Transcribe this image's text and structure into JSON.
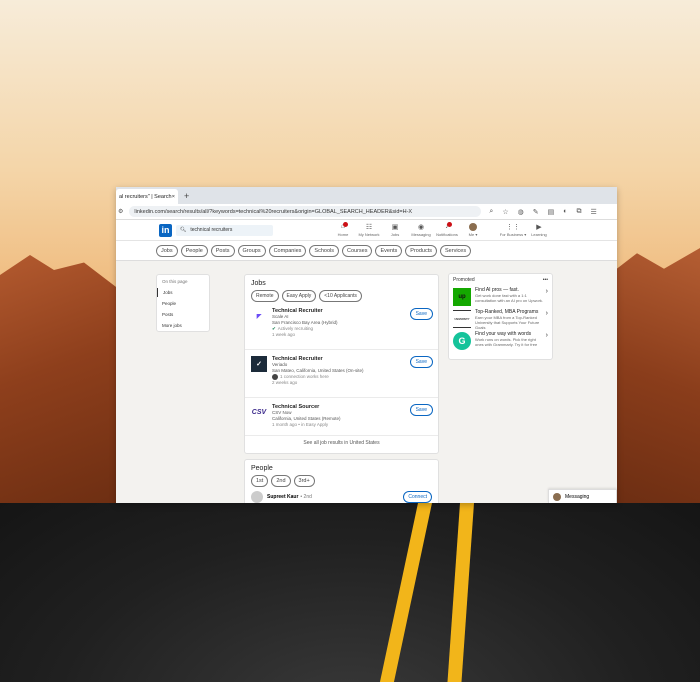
{
  "browser": {
    "tab_title": "al recruiters\" | Search",
    "tab_close": "×",
    "new_tab": "+",
    "url": "linkedin.com/search/results/all/?keywords=technical%20recruiters&origin=GLOBAL_SEARCH_HEADER&sid=H-X"
  },
  "linkedin_nav": {
    "logo": "in",
    "search_value": "technical recruiters",
    "items": [
      {
        "label": "Home",
        "icon": "home-icon",
        "glyph": "⌂",
        "badge": true
      },
      {
        "label": "My Network",
        "icon": "network-icon",
        "glyph": "☷",
        "badge": false
      },
      {
        "label": "Jobs",
        "icon": "briefcase-icon",
        "glyph": "▣",
        "badge": false
      },
      {
        "label": "Messaging",
        "icon": "message-icon",
        "glyph": "◉",
        "badge": false
      },
      {
        "label": "Notifications",
        "icon": "bell-icon",
        "glyph": "♪",
        "badge": true
      },
      {
        "label": "Me ▾",
        "icon": "avatar",
        "glyph": "",
        "badge": false
      }
    ],
    "business": "For Business ▾",
    "learning": "Learning"
  },
  "filters": [
    "Jobs",
    "People",
    "Posts",
    "Groups",
    "Companies",
    "Schools",
    "Courses",
    "Events",
    "Products",
    "Services"
  ],
  "left_nav": {
    "title": "On this page",
    "items": [
      "Jobs",
      "People",
      "Posts",
      "More jobs"
    ]
  },
  "jobs": {
    "title": "Jobs",
    "filters": [
      "Remote",
      "Easy Apply",
      "<10 Applicants"
    ],
    "list": [
      {
        "title": "Technical Recruiter",
        "company": "Scale AI",
        "location": "San Francisco Bay Area (Hybrid)",
        "meta": "Actively recruiting",
        "time": "1 week ago"
      },
      {
        "title": "Technical Recruiter",
        "company": "Veriado",
        "location": "San Mateo, California, United States (On-site)",
        "meta": "1 connection works here",
        "time": "2 weeks ago"
      },
      {
        "title": "Technical Sourcer",
        "company": "CSV Now",
        "location": "California, United States (Remote)",
        "meta": "1 month ago • in Easy Apply",
        "time": ""
      }
    ],
    "save_label": "Save",
    "see_all": "See all job results in United States"
  },
  "people": {
    "title": "People",
    "filters": [
      "1st",
      "2nd",
      "3rd+"
    ],
    "first_name": "Supreet Kaur",
    "first_degree": "• 2nd",
    "connect": "Connect"
  },
  "promoted": {
    "title": "Promoted",
    "more": "•••",
    "ads": [
      {
        "logo": "up",
        "title": "Find AI pros — fast.",
        "text": "Get work done fast with a 1:1 consultation with an AI pro on Upwork."
      },
      {
        "logo": "UNIVERSITY",
        "title": "Top-Ranked, MBA Programs",
        "text": "Earn your MBA from a Top-Ranked University that Supports Your Future Goals"
      },
      {
        "logo": "G",
        "title": "Find your way with words",
        "text": "Work runs on words. Pick the right ones with Grammarly. Try it for free"
      }
    ]
  },
  "messaging": {
    "label": "Messaging"
  },
  "colors": {
    "linkedin_blue": "#0a66c2",
    "upwork_green": "#14a800",
    "grammarly_green": "#15c39a"
  }
}
